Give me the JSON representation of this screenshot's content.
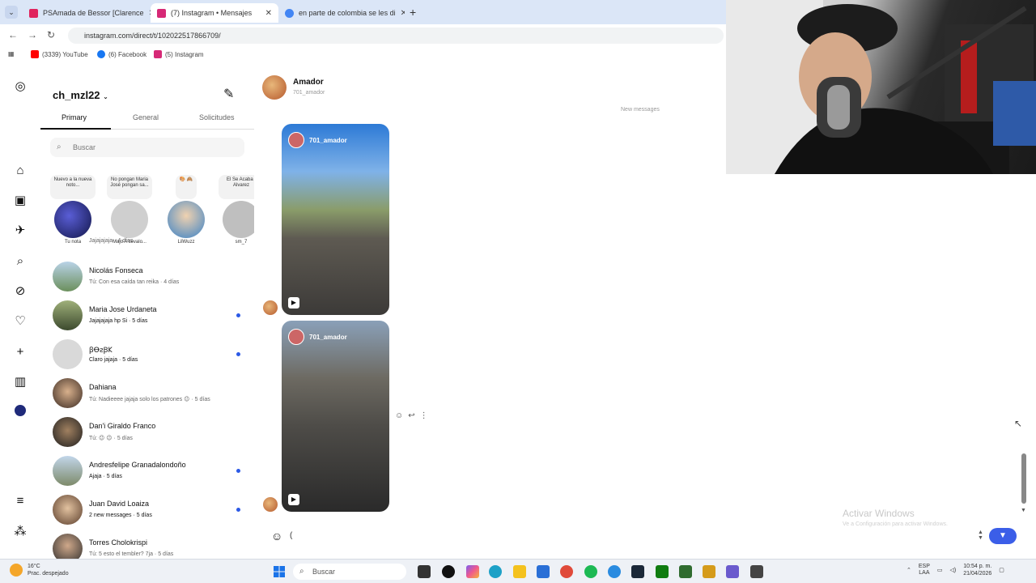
{
  "browser": {
    "tabs": [
      {
        "title": "PSAmada de Bessor [Clarence",
        "active": false,
        "favicon_color": "#e0245e"
      },
      {
        "title": "(7) Instagram • Mensajes",
        "active": true,
        "favicon_color": "#d62976"
      },
      {
        "title": "en parte de colombia se les di",
        "active": false,
        "favicon_color": "#4285f4"
      }
    ],
    "close_glyph": "✕",
    "new_tab_glyph": "+",
    "url": "instagram.com/direct/t/102022517866709/",
    "bookmarks": [
      {
        "label": "(3339) YouTube",
        "color": "#ff0000"
      },
      {
        "label": "(6) Facebook",
        "color": "#1877f2"
      },
      {
        "label": "(5) Instagram",
        "color": "#d62976"
      }
    ]
  },
  "inbox": {
    "username": "ch_mzl22",
    "tabs": [
      "Primary",
      "General",
      "Solicitudes"
    ],
    "search_placeholder": "Buscar",
    "notes": [
      {
        "bubble": "Nuevo a la nueva noto...",
        "name": "Tu nota"
      },
      {
        "bubble": "No pongan Maria José pongan sa...",
        "name": "Majo A'cevalo..."
      },
      {
        "bubble": "🎨 🙈",
        "name": "LilWuzz"
      },
      {
        "bubble": "El Se Acaba I Alvarez",
        "name": "sm_7"
      }
    ],
    "partial_preview": "Jajajajaja · 4 días",
    "threads": [
      {
        "name": "Nicolás Fonseca",
        "preview": "Tú: Con esa caída tan reika · 4 días",
        "unread": false
      },
      {
        "name": "Maria Jose Urdaneta",
        "preview": "Jajajajaja hp Si · 5 días",
        "unread": true
      },
      {
        "name": "ꞵꝊꙅꞴ𐌊",
        "preview": "Claro jajaja · 5 días",
        "unread": true
      },
      {
        "name": "Dahiana",
        "preview": "Tú: Nadieeee jajaja solo los patrones 😉 · 5 días",
        "unread": false
      },
      {
        "name": "Dan'i Giraldo Franco",
        "preview": "Tú: 😉 😉 · 5 días",
        "unread": false
      },
      {
        "name": "Andresfelipe Granadalondoño",
        "preview": "Ajaja · 5 días",
        "unread": true
      },
      {
        "name": "Juan David Loaiza",
        "preview": "2 new messages · 5 días",
        "unread": true
      },
      {
        "name": "Torres Cholokrispi",
        "preview": "Tú: 5 esto el tembler? 7ja · 5 días",
        "unread": false
      }
    ]
  },
  "conversation": {
    "name": "Amador",
    "handle": "701_amador",
    "divider": "New messages",
    "reels": [
      {
        "user": "701_amador"
      },
      {
        "user": "701_amador"
      }
    ],
    "actions": [
      "☺",
      "↩",
      "⋮"
    ],
    "composer_text": "("
  },
  "watermark": {
    "title": "Activar Windows",
    "subtitle": "Ve a Configuración para activar Windows."
  },
  "taskbar": {
    "weather_temp": "16°C",
    "weather_desc": "Prac. despejado",
    "search_placeholder": "Buscar",
    "lang_top": "ESP",
    "lang_bottom": "LAA",
    "time": "10:54 p. m.",
    "date": "21/04/2026"
  }
}
